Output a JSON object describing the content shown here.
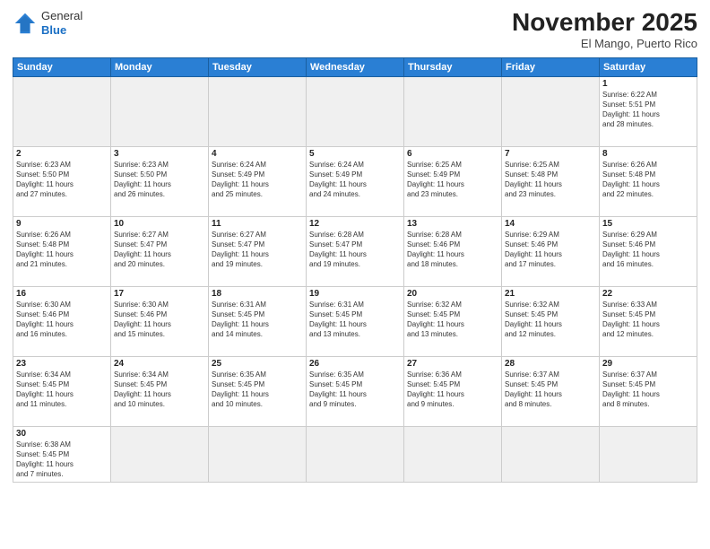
{
  "header": {
    "logo_line1": "General",
    "logo_line2": "Blue",
    "month_title": "November 2025",
    "location": "El Mango, Puerto Rico"
  },
  "days_of_week": [
    "Sunday",
    "Monday",
    "Tuesday",
    "Wednesday",
    "Thursday",
    "Friday",
    "Saturday"
  ],
  "weeks": [
    [
      {
        "day": "",
        "info": ""
      },
      {
        "day": "",
        "info": ""
      },
      {
        "day": "",
        "info": ""
      },
      {
        "day": "",
        "info": ""
      },
      {
        "day": "",
        "info": ""
      },
      {
        "day": "",
        "info": ""
      },
      {
        "day": "1",
        "info": "Sunrise: 6:22 AM\nSunset: 5:51 PM\nDaylight: 11 hours\nand 28 minutes."
      }
    ],
    [
      {
        "day": "2",
        "info": "Sunrise: 6:23 AM\nSunset: 5:50 PM\nDaylight: 11 hours\nand 27 minutes."
      },
      {
        "day": "3",
        "info": "Sunrise: 6:23 AM\nSunset: 5:50 PM\nDaylight: 11 hours\nand 26 minutes."
      },
      {
        "day": "4",
        "info": "Sunrise: 6:24 AM\nSunset: 5:49 PM\nDaylight: 11 hours\nand 25 minutes."
      },
      {
        "day": "5",
        "info": "Sunrise: 6:24 AM\nSunset: 5:49 PM\nDaylight: 11 hours\nand 24 minutes."
      },
      {
        "day": "6",
        "info": "Sunrise: 6:25 AM\nSunset: 5:49 PM\nDaylight: 11 hours\nand 23 minutes."
      },
      {
        "day": "7",
        "info": "Sunrise: 6:25 AM\nSunset: 5:48 PM\nDaylight: 11 hours\nand 23 minutes."
      },
      {
        "day": "8",
        "info": "Sunrise: 6:26 AM\nSunset: 5:48 PM\nDaylight: 11 hours\nand 22 minutes."
      }
    ],
    [
      {
        "day": "9",
        "info": "Sunrise: 6:26 AM\nSunset: 5:48 PM\nDaylight: 11 hours\nand 21 minutes."
      },
      {
        "day": "10",
        "info": "Sunrise: 6:27 AM\nSunset: 5:47 PM\nDaylight: 11 hours\nand 20 minutes."
      },
      {
        "day": "11",
        "info": "Sunrise: 6:27 AM\nSunset: 5:47 PM\nDaylight: 11 hours\nand 19 minutes."
      },
      {
        "day": "12",
        "info": "Sunrise: 6:28 AM\nSunset: 5:47 PM\nDaylight: 11 hours\nand 19 minutes."
      },
      {
        "day": "13",
        "info": "Sunrise: 6:28 AM\nSunset: 5:46 PM\nDaylight: 11 hours\nand 18 minutes."
      },
      {
        "day": "14",
        "info": "Sunrise: 6:29 AM\nSunset: 5:46 PM\nDaylight: 11 hours\nand 17 minutes."
      },
      {
        "day": "15",
        "info": "Sunrise: 6:29 AM\nSunset: 5:46 PM\nDaylight: 11 hours\nand 16 minutes."
      }
    ],
    [
      {
        "day": "16",
        "info": "Sunrise: 6:30 AM\nSunset: 5:46 PM\nDaylight: 11 hours\nand 16 minutes."
      },
      {
        "day": "17",
        "info": "Sunrise: 6:30 AM\nSunset: 5:46 PM\nDaylight: 11 hours\nand 15 minutes."
      },
      {
        "day": "18",
        "info": "Sunrise: 6:31 AM\nSunset: 5:45 PM\nDaylight: 11 hours\nand 14 minutes."
      },
      {
        "day": "19",
        "info": "Sunrise: 6:31 AM\nSunset: 5:45 PM\nDaylight: 11 hours\nand 13 minutes."
      },
      {
        "day": "20",
        "info": "Sunrise: 6:32 AM\nSunset: 5:45 PM\nDaylight: 11 hours\nand 13 minutes."
      },
      {
        "day": "21",
        "info": "Sunrise: 6:32 AM\nSunset: 5:45 PM\nDaylight: 11 hours\nand 12 minutes."
      },
      {
        "day": "22",
        "info": "Sunrise: 6:33 AM\nSunset: 5:45 PM\nDaylight: 11 hours\nand 12 minutes."
      }
    ],
    [
      {
        "day": "23",
        "info": "Sunrise: 6:34 AM\nSunset: 5:45 PM\nDaylight: 11 hours\nand 11 minutes."
      },
      {
        "day": "24",
        "info": "Sunrise: 6:34 AM\nSunset: 5:45 PM\nDaylight: 11 hours\nand 10 minutes."
      },
      {
        "day": "25",
        "info": "Sunrise: 6:35 AM\nSunset: 5:45 PM\nDaylight: 11 hours\nand 10 minutes."
      },
      {
        "day": "26",
        "info": "Sunrise: 6:35 AM\nSunset: 5:45 PM\nDaylight: 11 hours\nand 9 minutes."
      },
      {
        "day": "27",
        "info": "Sunrise: 6:36 AM\nSunset: 5:45 PM\nDaylight: 11 hours\nand 9 minutes."
      },
      {
        "day": "28",
        "info": "Sunrise: 6:37 AM\nSunset: 5:45 PM\nDaylight: 11 hours\nand 8 minutes."
      },
      {
        "day": "29",
        "info": "Sunrise: 6:37 AM\nSunset: 5:45 PM\nDaylight: 11 hours\nand 8 minutes."
      }
    ],
    [
      {
        "day": "30",
        "info": "Sunrise: 6:38 AM\nSunset: 5:45 PM\nDaylight: 11 hours\nand 7 minutes."
      },
      {
        "day": "",
        "info": ""
      },
      {
        "day": "",
        "info": ""
      },
      {
        "day": "",
        "info": ""
      },
      {
        "day": "",
        "info": ""
      },
      {
        "day": "",
        "info": ""
      },
      {
        "day": "",
        "info": ""
      }
    ]
  ]
}
